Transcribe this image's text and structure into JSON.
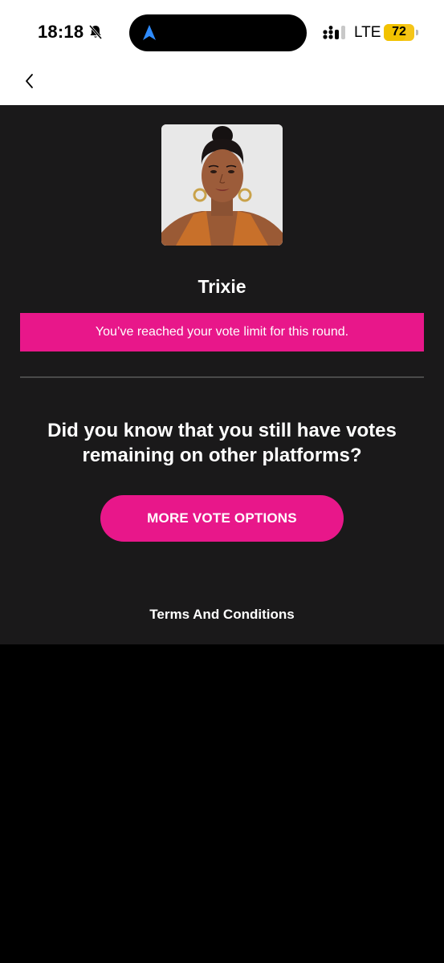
{
  "status_bar": {
    "time": "18:18",
    "network": "LTE",
    "battery": "72",
    "battery_level": 0.72,
    "icons": [
      "bell-muted-icon",
      "navigation-arrow-icon",
      "signal-icon",
      "battery-icon"
    ],
    "colors": {
      "battery": "#f5c518",
      "nav_arrow": "#2f8cff"
    }
  },
  "header": {
    "back_icon": "chevron-left-icon"
  },
  "contestant": {
    "name": "Trixie",
    "photo": "contestant-portrait"
  },
  "alert": {
    "message": "You’ve reached your vote limit for this round."
  },
  "prompt": {
    "question": "Did you know that you still have votes remaining on other platforms?"
  },
  "actions": {
    "more_vote_options": "MORE VOTE OPTIONS",
    "terms": "Terms And Conditions"
  },
  "theme": {
    "accent": "#e8178a",
    "panel_bg": "#1a191a",
    "page_bg": "#000000",
    "header_bg": "#ffffff"
  }
}
